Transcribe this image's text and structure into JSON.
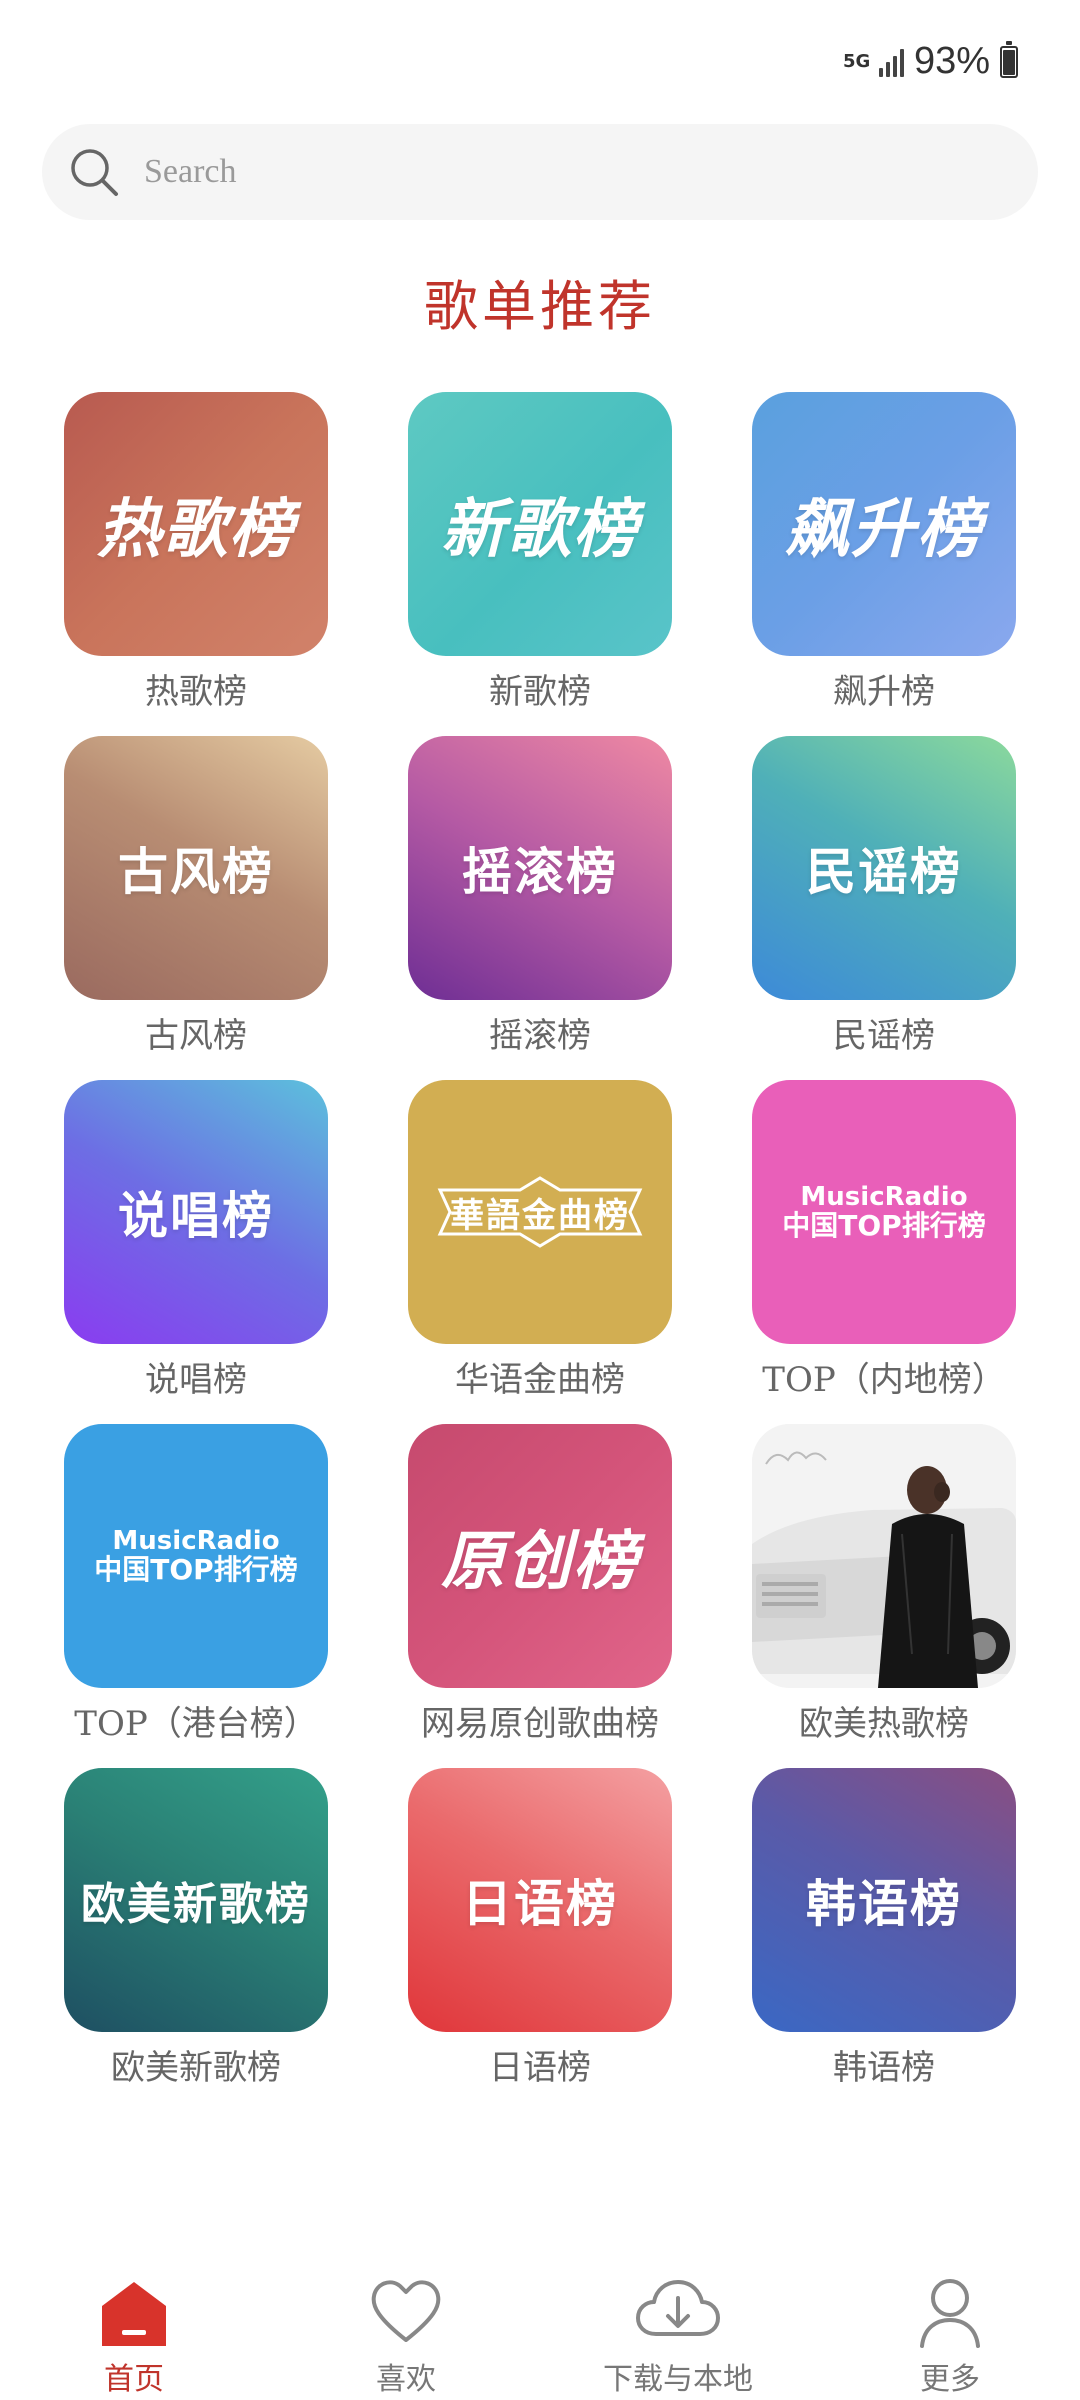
{
  "status_bar": {
    "network": "5G",
    "battery_percent": "93%"
  },
  "search": {
    "placeholder": "Search"
  },
  "section_title": "歌单推荐",
  "playlists": [
    {
      "tile_text": "热歌榜",
      "label": "热歌榜"
    },
    {
      "tile_text": "新歌榜",
      "label": "新歌榜"
    },
    {
      "tile_text": "飙升榜",
      "label": "飙升榜"
    },
    {
      "tile_text": "古风榜",
      "label": "古风榜"
    },
    {
      "tile_text": "摇滚榜",
      "label": "摇滚榜"
    },
    {
      "tile_text": "民谣榜",
      "label": "民谣榜"
    },
    {
      "tile_text": "说唱榜",
      "label": "说唱榜"
    },
    {
      "tile_text": "華語金曲榜",
      "label": "华语金曲榜"
    },
    {
      "tile_line1": "MusicRadio",
      "tile_line2": "中国TOP排行榜",
      "label": "TOP（内地榜）"
    },
    {
      "tile_line1": "MusicRadio",
      "tile_line2": "中国TOP排行榜",
      "label": "TOP（港台榜）"
    },
    {
      "tile_text": "原创榜",
      "label": "网易原创歌曲榜"
    },
    {
      "label": "欧美热歌榜"
    },
    {
      "tile_text": "欧美新歌榜",
      "label": "欧美新歌榜"
    },
    {
      "tile_text": "日语榜",
      "label": "日语榜"
    },
    {
      "tile_text": "韩语榜",
      "label": "韩语榜"
    }
  ],
  "bottom_nav": [
    {
      "label": "首页",
      "icon": "home-icon",
      "active": true
    },
    {
      "label": "喜欢",
      "icon": "heart-icon"
    },
    {
      "label": "下载与本地",
      "icon": "cloud-download-icon"
    },
    {
      "label": "更多",
      "icon": "user-icon"
    }
  ],
  "colors": {
    "accent": "#c0342b"
  }
}
